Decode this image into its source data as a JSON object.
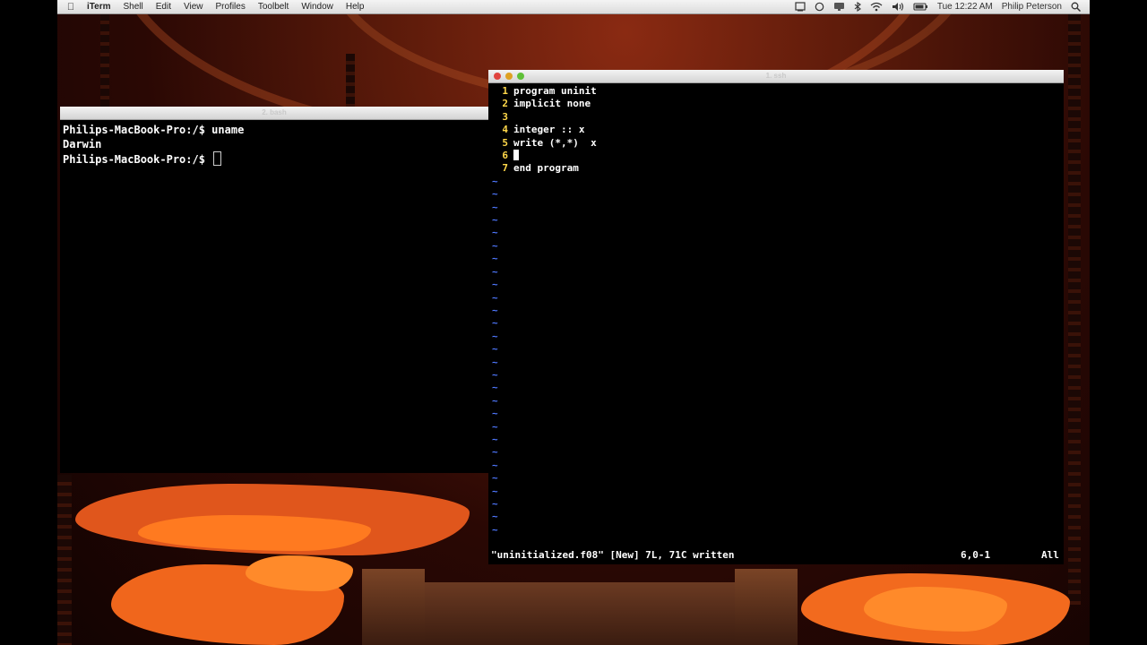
{
  "menubar": {
    "apple_icon": "apple-icon",
    "app_name": "iTerm",
    "items": [
      "Shell",
      "Edit",
      "View",
      "Profiles",
      "Toolbelt",
      "Window",
      "Help"
    ],
    "clock": "Tue 12:22 AM",
    "user": "Philip Peterson"
  },
  "left_window": {
    "title": "2. bash",
    "lines": [
      "Philips-MacBook-Pro:/$ uname",
      "Darwin",
      "Philips-MacBook-Pro:/$ "
    ]
  },
  "right_window": {
    "title": "1. ssh",
    "code_lines": [
      {
        "num": "1",
        "text": "program uninit"
      },
      {
        "num": "2",
        "text": "implicit none"
      },
      {
        "num": "3",
        "text": ""
      },
      {
        "num": "4",
        "text": "integer :: x"
      },
      {
        "num": "5",
        "text": "write (*,*)  x"
      },
      {
        "num": "6",
        "text": ""
      },
      {
        "num": "7",
        "text": "end program"
      }
    ],
    "tilde": "~",
    "status_message": "\"uninitialized.f08\" [New] 7L, 71C written",
    "cursor_pos": "6,0-1",
    "scroll": "All"
  },
  "colors": {
    "line_number": "#ffd84a",
    "tilde": "#4f78ff",
    "close": "#e0443e",
    "minimize": "#dea123",
    "zoom": "#5fc038"
  }
}
